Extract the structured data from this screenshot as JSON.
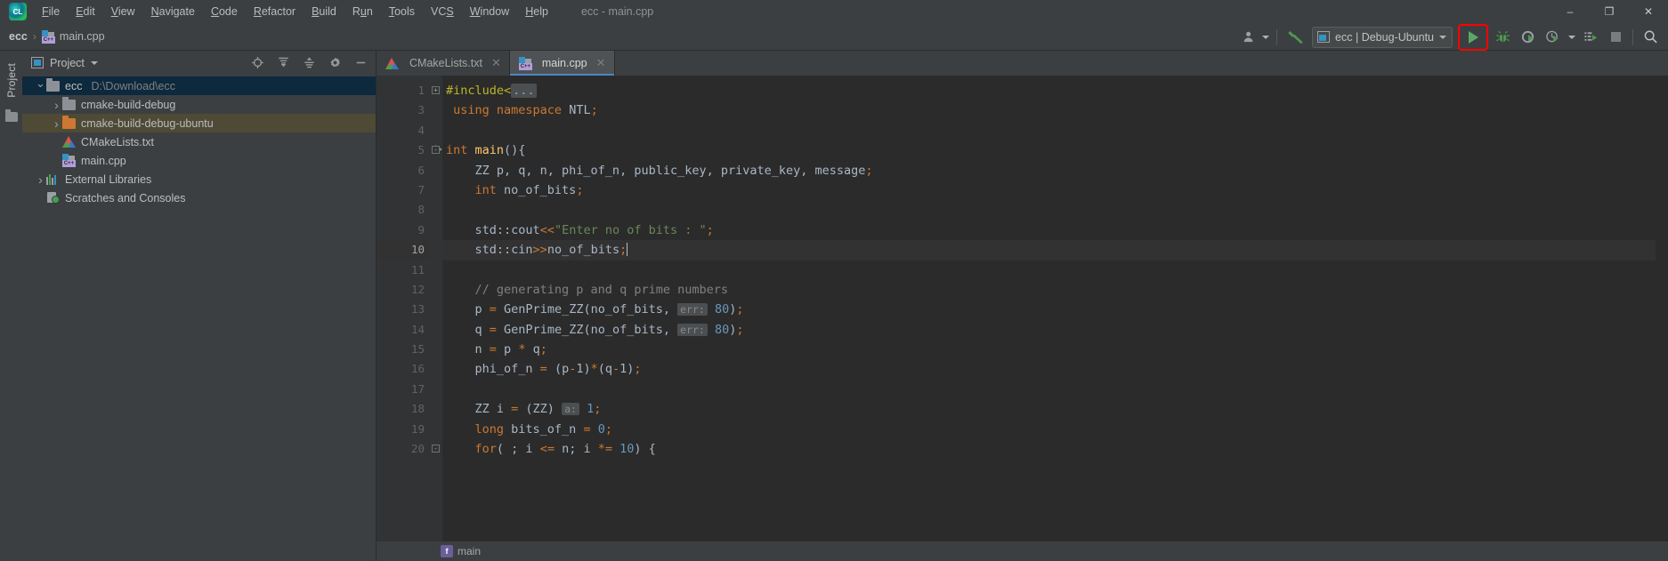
{
  "window": {
    "title": "ecc - main.cpp",
    "controls": {
      "minimize": "–",
      "maximize": "❐",
      "close": "✕"
    }
  },
  "menubar": {
    "items": [
      {
        "label": "File"
      },
      {
        "label": "Edit"
      },
      {
        "label": "View"
      },
      {
        "label": "Navigate"
      },
      {
        "label": "Code"
      },
      {
        "label": "Refactor"
      },
      {
        "label": "Build"
      },
      {
        "label": "Run"
      },
      {
        "label": "Tools"
      },
      {
        "label": "VCS"
      },
      {
        "label": "Window"
      },
      {
        "label": "Help"
      }
    ]
  },
  "navbar": {
    "breadcrumb": [
      {
        "label": "ecc",
        "icon": ""
      },
      {
        "label": "main.cpp",
        "icon": "cpp-file-icon"
      }
    ],
    "separator": "›",
    "run_config": {
      "label": "ecc | Debug-Ubuntu",
      "icon": "run-config-icon",
      "dropdown": "▾"
    },
    "buttons": [
      {
        "name": "user-avatar-button",
        "glyph": "👤"
      },
      {
        "name": "build-hammer-button",
        "glyph": "hammer"
      },
      {
        "name": "run-button",
        "glyph": "play"
      },
      {
        "name": "debug-button",
        "glyph": "bug"
      },
      {
        "name": "run-with-coverage-button",
        "glyph": "coverage"
      },
      {
        "name": "profile-button",
        "glyph": "profiler"
      },
      {
        "name": "attach-to-process-button",
        "glyph": "attach"
      },
      {
        "name": "stop-button",
        "glyph": "stop"
      },
      {
        "name": "search-everywhere-button",
        "glyph": "search"
      }
    ]
  },
  "sidebar": {
    "vertical_tab": "Project",
    "header": {
      "title": "Project",
      "dropdown": "▾",
      "actions": [
        {
          "name": "select-opened-file-button",
          "glyph": "target"
        },
        {
          "name": "expand-all-button",
          "glyph": "expand"
        },
        {
          "name": "collapse-all-button",
          "glyph": "collapse"
        },
        {
          "name": "settings-gear-button",
          "glyph": "gear"
        },
        {
          "name": "hide-panel-button",
          "glyph": "minus"
        }
      ]
    },
    "tree": [
      {
        "label": "ecc",
        "path": "D:\\Download\\ecc",
        "icon": "folder-icon",
        "arrow": "down",
        "indent": 0,
        "state": "selected-blue"
      },
      {
        "label": "cmake-build-debug",
        "path": "",
        "icon": "folder-icon",
        "arrow": "right",
        "indent": 1,
        "state": "normal"
      },
      {
        "label": "cmake-build-debug-ubuntu",
        "path": "",
        "icon": "folder-orange-icon",
        "arrow": "right",
        "indent": 1,
        "state": "selected-olive"
      },
      {
        "label": "CMakeLists.txt",
        "path": "",
        "icon": "cmake-file-icon",
        "arrow": "none",
        "indent": 1,
        "state": "normal"
      },
      {
        "label": "main.cpp",
        "path": "",
        "icon": "cpp-file-icon",
        "arrow": "none",
        "indent": 1,
        "state": "normal"
      },
      {
        "label": "External Libraries",
        "path": "",
        "icon": "libraries-icon",
        "arrow": "right",
        "indent": 0,
        "state": "normal"
      },
      {
        "label": "Scratches and Consoles",
        "path": "",
        "icon": "scratches-icon",
        "arrow": "none",
        "indent": 0,
        "state": "normal"
      }
    ]
  },
  "editor": {
    "tabs": [
      {
        "label": "CMakeLists.txt",
        "icon": "cmake-file-icon",
        "active": false,
        "close": "✕"
      },
      {
        "label": "main.cpp",
        "icon": "cpp-file-icon",
        "active": true,
        "close": "✕"
      }
    ],
    "current_line": 10,
    "breadcrumb_function": "main",
    "breadcrumb_badge": "f",
    "lines": [
      {
        "no": "1",
        "fold": "+",
        "runmark": false,
        "segments": [
          {
            "t": "#include<",
            "c": "pp"
          },
          {
            "t": "...",
            "c": "fold-ph"
          }
        ]
      },
      {
        "no": "3",
        "fold": "",
        "runmark": false,
        "segments": [
          {
            "t": " ",
            "c": "t"
          },
          {
            "t": "using namespace",
            "c": "k"
          },
          {
            "t": " NTL",
            "c": "t"
          },
          {
            "t": ";",
            "c": "k"
          }
        ]
      },
      {
        "no": "4",
        "fold": "",
        "runmark": false,
        "segments": []
      },
      {
        "no": "5",
        "fold": "-",
        "runmark": true,
        "segments": [
          {
            "t": "int ",
            "c": "k"
          },
          {
            "t": "main",
            "c": "fn"
          },
          {
            "t": "(){",
            "c": "t"
          }
        ]
      },
      {
        "no": "6",
        "fold": "",
        "runmark": false,
        "segments": [
          {
            "t": "    ZZ p, q, n, phi_of_n, public_key, private_key, message",
            "c": "t"
          },
          {
            "t": ";",
            "c": "k"
          }
        ]
      },
      {
        "no": "7",
        "fold": "",
        "runmark": false,
        "segments": [
          {
            "t": "    ",
            "c": "t"
          },
          {
            "t": "int",
            "c": "k"
          },
          {
            "t": " no_of_bits",
            "c": "t"
          },
          {
            "t": ";",
            "c": "k"
          }
        ]
      },
      {
        "no": "8",
        "fold": "",
        "runmark": false,
        "segments": []
      },
      {
        "no": "9",
        "fold": "",
        "runmark": false,
        "segments": [
          {
            "t": "    std::cout",
            "c": "t"
          },
          {
            "t": "<<",
            "c": "k"
          },
          {
            "t": "\"Enter no of bits : \"",
            "c": "s"
          },
          {
            "t": ";",
            "c": "k"
          }
        ]
      },
      {
        "no": "10",
        "fold": "",
        "runmark": false,
        "segments": [
          {
            "t": "    std::cin",
            "c": "t"
          },
          {
            "t": ">>",
            "c": "k"
          },
          {
            "t": "no_of_bits",
            "c": "t"
          },
          {
            "t": ";",
            "c": "k"
          },
          {
            "t": "|",
            "c": "caret"
          }
        ]
      },
      {
        "no": "11",
        "fold": "",
        "runmark": false,
        "segments": []
      },
      {
        "no": "12",
        "fold": "",
        "runmark": false,
        "segments": [
          {
            "t": "    // generating p and q prime numbers",
            "c": "cm"
          }
        ]
      },
      {
        "no": "13",
        "fold": "",
        "runmark": false,
        "segments": [
          {
            "t": "    p ",
            "c": "t"
          },
          {
            "t": "=",
            "c": "k"
          },
          {
            "t": " GenPrime_ZZ(no_of_bits, ",
            "c": "t"
          },
          {
            "t": "err:",
            "c": "hint"
          },
          {
            "t": " ",
            "c": "t"
          },
          {
            "t": "80",
            "c": "n"
          },
          {
            "t": ")",
            "c": "t"
          },
          {
            "t": ";",
            "c": "k"
          }
        ]
      },
      {
        "no": "14",
        "fold": "",
        "runmark": false,
        "segments": [
          {
            "t": "    q ",
            "c": "t"
          },
          {
            "t": "=",
            "c": "k"
          },
          {
            "t": " GenPrime_ZZ(no_of_bits, ",
            "c": "t"
          },
          {
            "t": "err:",
            "c": "hint"
          },
          {
            "t": " ",
            "c": "t"
          },
          {
            "t": "80",
            "c": "n"
          },
          {
            "t": ")",
            "c": "t"
          },
          {
            "t": ";",
            "c": "k"
          }
        ]
      },
      {
        "no": "15",
        "fold": "",
        "runmark": false,
        "segments": [
          {
            "t": "    n ",
            "c": "t"
          },
          {
            "t": "=",
            "c": "k"
          },
          {
            "t": " p ",
            "c": "t"
          },
          {
            "t": "*",
            "c": "k"
          },
          {
            "t": " q",
            "c": "t"
          },
          {
            "t": ";",
            "c": "k"
          }
        ]
      },
      {
        "no": "16",
        "fold": "",
        "runmark": false,
        "segments": [
          {
            "t": "    phi_of_n ",
            "c": "t"
          },
          {
            "t": "=",
            "c": "k"
          },
          {
            "t": " (p",
            "c": "t"
          },
          {
            "t": "-",
            "c": "k"
          },
          {
            "t": "1)",
            "c": "t"
          },
          {
            "t": "*",
            "c": "k"
          },
          {
            "t": "(q",
            "c": "t"
          },
          {
            "t": "-",
            "c": "k"
          },
          {
            "t": "1)",
            "c": "t"
          },
          {
            "t": ";",
            "c": "k"
          }
        ]
      },
      {
        "no": "17",
        "fold": "",
        "runmark": false,
        "segments": []
      },
      {
        "no": "18",
        "fold": "",
        "runmark": false,
        "segments": [
          {
            "t": "    ZZ i ",
            "c": "t"
          },
          {
            "t": "=",
            "c": "k"
          },
          {
            "t": " (ZZ) ",
            "c": "t"
          },
          {
            "t": "a:",
            "c": "hint"
          },
          {
            "t": " ",
            "c": "t"
          },
          {
            "t": "1",
            "c": "n"
          },
          {
            "t": ";",
            "c": "k"
          }
        ]
      },
      {
        "no": "19",
        "fold": "",
        "runmark": false,
        "segments": [
          {
            "t": "    ",
            "c": "t"
          },
          {
            "t": "long",
            "c": "k"
          },
          {
            "t": " bits_of_n ",
            "c": "t"
          },
          {
            "t": "=",
            "c": "k"
          },
          {
            "t": " ",
            "c": "t"
          },
          {
            "t": "0",
            "c": "n"
          },
          {
            "t": ";",
            "c": "k"
          }
        ]
      },
      {
        "no": "20",
        "fold": "-",
        "runmark": false,
        "segments": [
          {
            "t": "    ",
            "c": "t"
          },
          {
            "t": "for",
            "c": "k"
          },
          {
            "t": "( ; i ",
            "c": "t"
          },
          {
            "t": "<=",
            "c": "k"
          },
          {
            "t": " n; i ",
            "c": "t"
          },
          {
            "t": "*=",
            "c": "k"
          },
          {
            "t": " ",
            "c": "t"
          },
          {
            "t": "10",
            "c": "n"
          },
          {
            "t": ") {",
            "c": "t"
          }
        ]
      }
    ]
  },
  "colors": {
    "accent_green": "#59a869",
    "highlight_red": "#ff0000",
    "tab_underline": "#4a88c7",
    "selection_blue": "#0d293e",
    "selection_olive": "#4e4a36",
    "editor_bg": "#2b2b2b",
    "chrome_bg": "#3c3f41"
  }
}
